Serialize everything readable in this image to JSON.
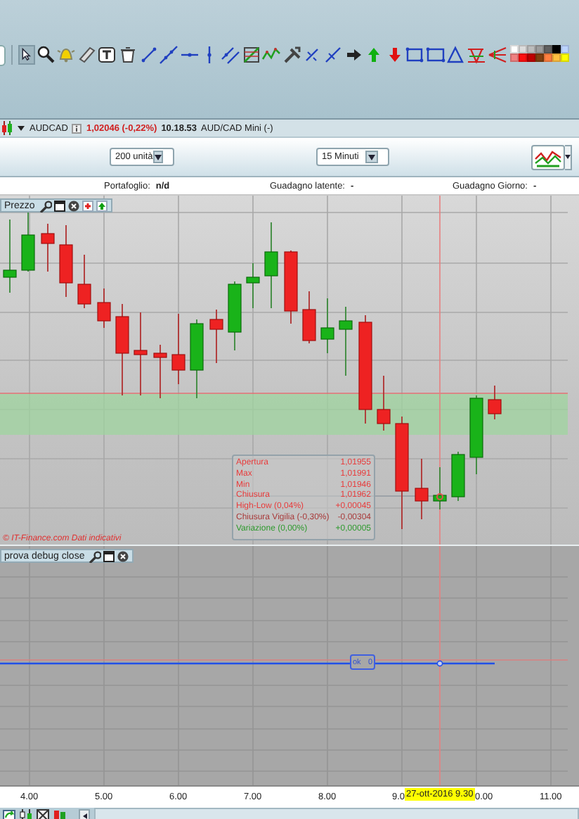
{
  "toolbar": {
    "palette": [
      {
        "color": "#ffffff"
      },
      {
        "color": "#dcdcdc"
      },
      {
        "color": "#bcbcbc"
      },
      {
        "color": "#9c9c9c"
      },
      {
        "color": "#606060"
      },
      {
        "color": "#000000"
      },
      {
        "color": "#bcd4ff"
      },
      {
        "color": "#f08080"
      },
      {
        "color": "#ff1010"
      },
      {
        "color": "#c00000"
      },
      {
        "color": "#804010"
      },
      {
        "color": "#ff8040"
      },
      {
        "color": "#ffc040"
      },
      {
        "color": "#ffff00"
      }
    ]
  },
  "symbol_bar": {
    "symbol": "AUDCAD",
    "price": "1,02046 (-0,22%)",
    "time": "10.18.53",
    "description": "AUD/CAD Mini (-)"
  },
  "controls": {
    "quantity": "200 unità",
    "timeframe": "15 Minuti"
  },
  "info": [
    {
      "label": "Portafoglio:",
      "value": "n/d"
    },
    {
      "label": "Guadagno latente:",
      "value": "-"
    },
    {
      "label": "Guadagno Giorno:",
      "value": "-"
    }
  ],
  "price_panel": {
    "title": "Prezzo",
    "credit": "© IT-Finance.com Dati indicativi",
    "tooltip": [
      {
        "label": "Apertura",
        "value": "1,01955",
        "color": "#e83c3c"
      },
      {
        "label": "Max",
        "value": "1,01991",
        "color": "#e83c3c"
      },
      {
        "label": "Min",
        "value": "1,01946",
        "color": "#e83c3c"
      },
      {
        "label": "Chiusura",
        "value": "1,01962",
        "color": "#e83c3c"
      },
      {
        "label": "High-Low (0,04%)",
        "value": "+0,00045",
        "color": "#e83c3c"
      },
      {
        "label": "Chiusura Vigilia (-0,30%)",
        "value": "-0,00304",
        "color": "#a83a3a"
      },
      {
        "label": "Variazione (0,00%)",
        "value": "+0,00005",
        "color": "#2e9a2e"
      }
    ]
  },
  "indicator_panel": {
    "title": "prova debug close",
    "marker_label": "ok",
    "marker_value": "0"
  },
  "time_axis": {
    "ticks": [
      "4.00",
      "5.00",
      "6.00",
      "7.00",
      "8.00",
      "9.0",
      "0.00",
      "11.00"
    ],
    "cursor": "27-ott-2016 9.30"
  }
}
